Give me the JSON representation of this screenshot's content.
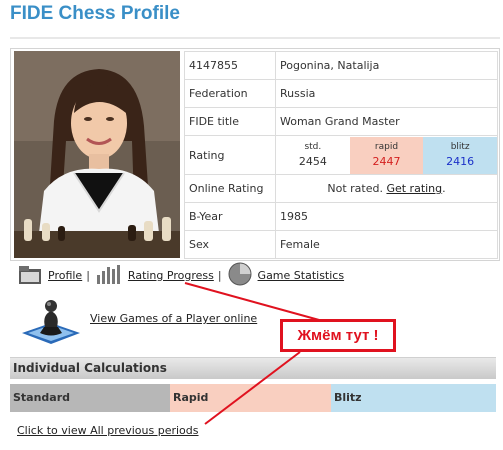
{
  "page": {
    "title": "FIDE Chess Profile"
  },
  "profile": {
    "fide_id": "4147855",
    "name": "Pogonina, Natalija",
    "federation_label": "Federation",
    "federation": "Russia",
    "title_label": "FIDE title",
    "title": "Woman Grand Master",
    "rating_label": "Rating",
    "ratings": {
      "std_label": "std.",
      "std": "2454",
      "rapid_label": "rapid",
      "rapid": "2447",
      "blitz_label": "blitz",
      "blitz": "2416"
    },
    "online_label": "Online Rating",
    "online_text": "Not rated.",
    "online_link": "Get rating",
    "online_suffix": ".",
    "byear_label": "B-Year",
    "byear": "1985",
    "sex_label": "Sex",
    "sex": "Female"
  },
  "nav": {
    "profile": "Profile",
    "sep": "|",
    "rating_progress": "Rating Progress",
    "game_statistics": "Game Statistics"
  },
  "games_link": "View Games of a Player online",
  "individual": {
    "header": "Individual Calculations",
    "standard": "Standard",
    "rapid": "Rapid",
    "blitz": "Blitz",
    "previous_link": "Click to view All previous periods"
  },
  "callout": "Жмём тут !",
  "colors": {
    "title": "#3a8fc7",
    "rapid_bg": "#f9cfc0",
    "blitz_bg": "#bfe0f0",
    "rapid_text": "#d4201f",
    "blitz_text": "#1a30c8",
    "annotation": "#e0121f"
  }
}
